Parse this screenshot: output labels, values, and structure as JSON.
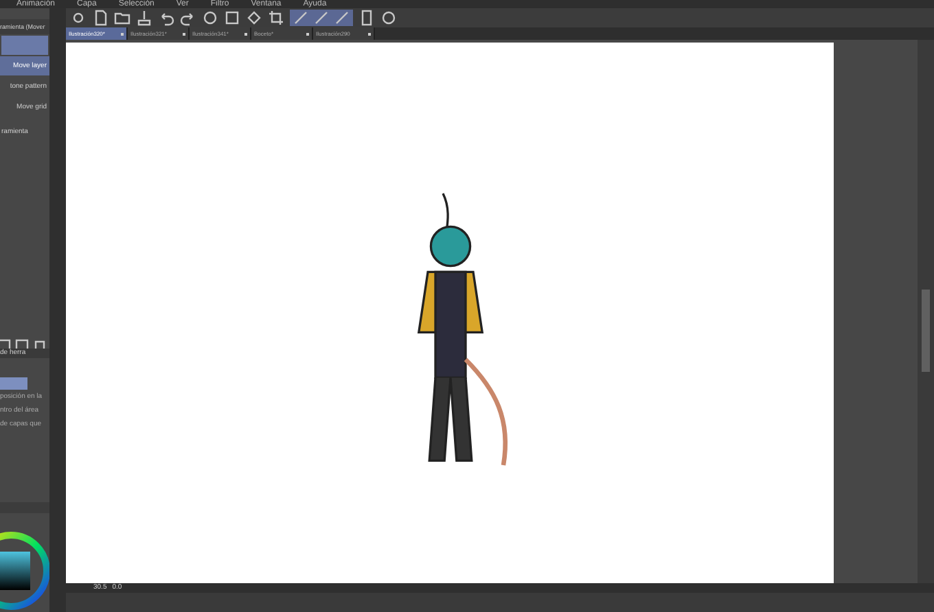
{
  "menu": [
    "Animación",
    "Capa",
    "Selección",
    "Ver",
    "Filtro",
    "Ventana",
    "Ayuda"
  ],
  "tool_panel": {
    "title": "ramienta (Mover",
    "items": [
      {
        "label": "Move layer",
        "selected": true
      },
      {
        "label": "tone pattern",
        "selected": false
      },
      {
        "label": "Move grid",
        "selected": false
      }
    ],
    "footer": "ramienta"
  },
  "layer_panel": {
    "blend": "de herra",
    "rows": [
      "posición en la",
      "ntro del área",
      "de capas que"
    ]
  },
  "tabs": [
    {
      "label": "Ilustración320*",
      "selected": true
    },
    {
      "label": "Ilustración321*",
      "selected": false
    },
    {
      "label": "Ilustración341*",
      "selected": false
    },
    {
      "label": "Boceto*",
      "selected": false
    },
    {
      "label": "Ilustración290",
      "selected": false
    }
  ],
  "status_bar": {
    "zoom": "30.5",
    "angle": "0.0"
  }
}
